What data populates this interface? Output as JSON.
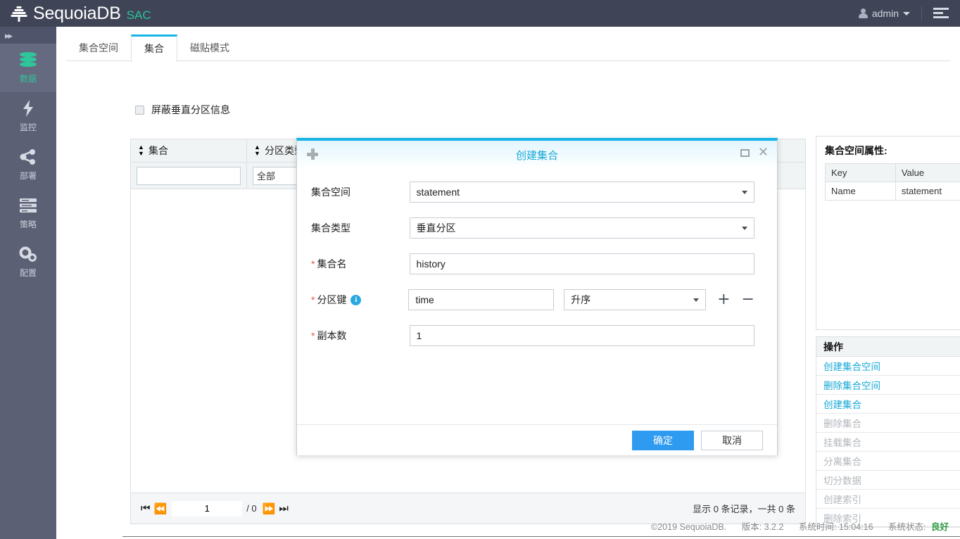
{
  "header": {
    "brand": "SequoiaDB",
    "brand_sub": "SAC",
    "user": "admin",
    "brand_accent": "#29c49b",
    "menu_icon": "hamburger-icon",
    "user_icon": "user-icon"
  },
  "sidebar": {
    "collapse_icon": "double-chevron-right-icon",
    "items": [
      {
        "label": "数据",
        "icon": "database-icon",
        "active": true
      },
      {
        "label": "监控",
        "icon": "bolt-icon",
        "active": false
      },
      {
        "label": "部署",
        "icon": "share-icon",
        "active": false
      },
      {
        "label": "策略",
        "icon": "list-icon",
        "active": false
      },
      {
        "label": "配置",
        "icon": "gears-icon",
        "active": false
      }
    ]
  },
  "tabs": [
    {
      "label": "集合空间",
      "active": false
    },
    {
      "label": "集合",
      "active": true
    },
    {
      "label": "磁贴模式",
      "active": false
    }
  ],
  "filter_checkbox": {
    "label": "屏蔽垂直分区信息",
    "checked": false
  },
  "table": {
    "columns": [
      {
        "label": "集合",
        "sortable": true
      },
      {
        "label": "分区类型",
        "sortable": true
      },
      {
        "label": "",
        "sortable": false
      }
    ],
    "filters": {
      "collection_value": "",
      "partition_type_value": "全部"
    },
    "rows": [],
    "pagination": {
      "first": "⏮",
      "prev": "⏪",
      "page": "1",
      "total_pages": "/ 0",
      "next": "⏩",
      "last": "⏭",
      "summary": "显示 0 条记录，一共 0 条"
    }
  },
  "properties_panel": {
    "title": "集合空间属性:",
    "columns": [
      "Key",
      "Value"
    ],
    "rows": [
      [
        "Name",
        "statement"
      ]
    ]
  },
  "operations_panel": {
    "title": "操作",
    "items": [
      {
        "label": "创建集合空间",
        "enabled": true
      },
      {
        "label": "删除集合空间",
        "enabled": true
      },
      {
        "label": "创建集合",
        "enabled": true
      },
      {
        "label": "删除集合",
        "enabled": false
      },
      {
        "label": "挂载集合",
        "enabled": false
      },
      {
        "label": "分离集合",
        "enabled": false
      },
      {
        "label": "切分数据",
        "enabled": false
      },
      {
        "label": "创建索引",
        "enabled": false
      },
      {
        "label": "删除索引",
        "enabled": false
      }
    ]
  },
  "modal": {
    "title": "创建集合",
    "plus_icon": "plus-icon",
    "maximize_icon": "maximize-icon",
    "close_icon": "close-icon",
    "fields": {
      "collection_space": {
        "label": "集合空间",
        "value": "statement",
        "required": false
      },
      "collection_type": {
        "label": "集合类型",
        "value": "垂直分区",
        "required": false
      },
      "collection_name": {
        "label": "集合名",
        "value": "history",
        "required": true
      },
      "partition_key": {
        "label": "分区键",
        "required": true,
        "info_icon": "info-icon",
        "value": "time",
        "order_value": "升序",
        "add_icon": "plus-icon",
        "remove_icon": "minus-icon"
      },
      "replica_count": {
        "label": "副本数",
        "value": "1",
        "required": true
      }
    },
    "confirm_label": "确定",
    "cancel_label": "取消"
  },
  "footer": {
    "copyright": "©2019 SequoiaDB.",
    "version": "版本: 3.2.2",
    "system_time": "系统时间: 15:04:16",
    "status_label": "系统状态:",
    "status_value": "良好",
    "status_color": "#2f9e44"
  }
}
